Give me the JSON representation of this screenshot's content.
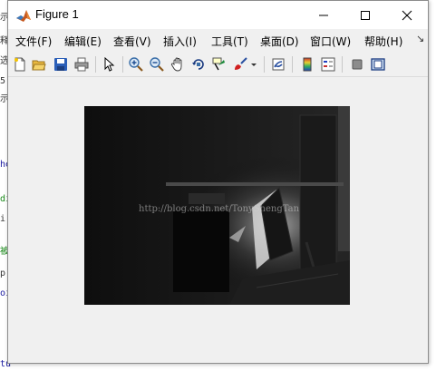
{
  "window": {
    "title": "Figure 1"
  },
  "menubar": {
    "items": [
      {
        "label": "文件(F)"
      },
      {
        "label": "编辑(E)"
      },
      {
        "label": "查看(V)"
      },
      {
        "label": "插入(I)"
      },
      {
        "label": "工具(T)"
      },
      {
        "label": "桌面(D)"
      },
      {
        "label": "窗口(W)"
      },
      {
        "label": "帮助(H)"
      }
    ],
    "more": "↘"
  },
  "toolbar": {
    "icons": [
      "new-figure-icon",
      "open-file-icon",
      "save-icon",
      "print-icon",
      "pointer-icon",
      "zoom-in-icon",
      "zoom-out-icon",
      "pan-icon",
      "rotate-3d-icon",
      "data-cursor-icon",
      "brush-icon",
      "brush-dropdown-icon",
      "link-plot-icon",
      "colorbar-icon",
      "legend-icon",
      "hide-plot-tools-icon",
      "show-plot-tools-icon"
    ]
  },
  "figure": {
    "watermark": "http://blog.csdn.net/TonyShengTan"
  },
  "background_strip": {
    "glyphs": [
      "示",
      "释",
      "选",
      "5",
      "示",
      "he",
      "di",
      "i",
      "被",
      "p",
      "oi",
      "tu"
    ]
  },
  "colors": {
    "window_bg": "#f0f0f0",
    "titlebar_bg": "#ffffff",
    "image_bg": "#0a0a0a"
  }
}
